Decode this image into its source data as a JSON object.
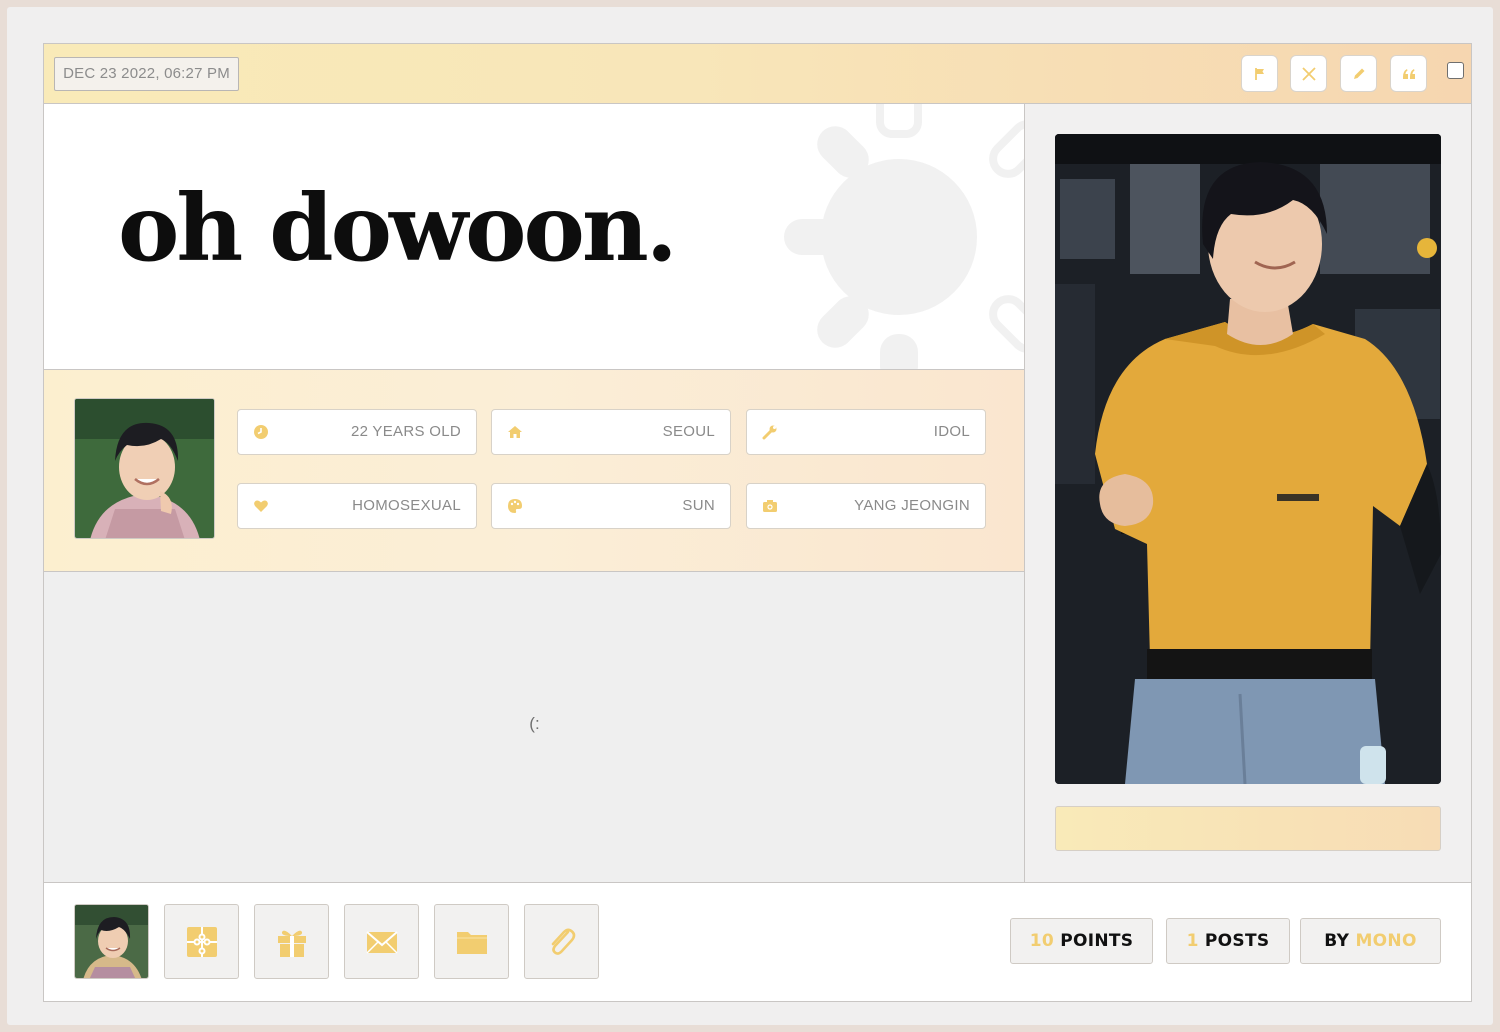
{
  "topbar": {
    "date": "DEC 23 2022, 06:27 PM",
    "tools": [
      {
        "icon": "flag-icon"
      },
      {
        "icon": "close-icon"
      },
      {
        "icon": "pencil-icon"
      },
      {
        "icon": "quote-icon"
      }
    ]
  },
  "title": "oh dowoon.",
  "info": [
    {
      "icon": "clock-icon",
      "label": "22 YEARS OLD"
    },
    {
      "icon": "home-icon",
      "label": "SEOUL"
    },
    {
      "icon": "wrench-icon",
      "label": "IDOL"
    },
    {
      "icon": "heart-icon",
      "label": "HOMOSEXUAL"
    },
    {
      "icon": "palette-icon",
      "label": "SUN"
    },
    {
      "icon": "camera-icon",
      "label": "YANG JEONGIN"
    }
  ],
  "content": {
    "text": "(:"
  },
  "footer": {
    "buttons": [
      {
        "icon": "puzzle-icon"
      },
      {
        "icon": "gift-icon"
      },
      {
        "icon": "envelope-icon"
      },
      {
        "icon": "folder-icon"
      },
      {
        "icon": "paperclip-icon"
      }
    ],
    "points_value": "10",
    "points_label": "POINTS",
    "posts_value": "1",
    "posts_label": "POSTS",
    "by_label": "BY",
    "author": "MONO"
  },
  "colors": {
    "accent": "#f2cd70",
    "topbar_start": "#f9eab8",
    "topbar_end": "#f6d6b0",
    "band": "#fcefcf",
    "content_bg": "#efefef"
  }
}
